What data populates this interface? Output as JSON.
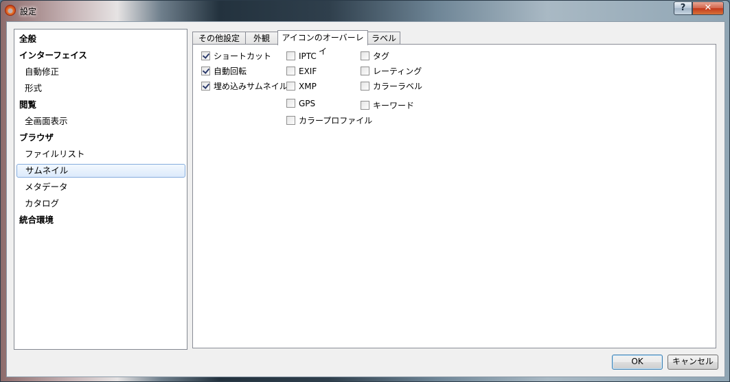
{
  "window": {
    "title": "設定",
    "help_label": "?",
    "close_label": "✕"
  },
  "sidebar": {
    "items": [
      {
        "label": "全般",
        "level": "category"
      },
      {
        "label": "インターフェイス",
        "level": "category"
      },
      {
        "label": "自動修正",
        "level": "child"
      },
      {
        "label": "形式",
        "level": "child"
      },
      {
        "label": "閲覧",
        "level": "category"
      },
      {
        "label": "全画面表示",
        "level": "child"
      },
      {
        "label": "ブラウザ",
        "level": "category"
      },
      {
        "label": "ファイルリスト",
        "level": "child"
      },
      {
        "label": "サムネイル",
        "level": "child",
        "selected": true
      },
      {
        "label": "メタデータ",
        "level": "child"
      },
      {
        "label": "カタログ",
        "level": "child"
      },
      {
        "label": "統合環境",
        "level": "category"
      }
    ]
  },
  "tabs": [
    {
      "label": "その他設定"
    },
    {
      "label": "外観"
    },
    {
      "label": "アイコンのオーバーレイ",
      "active": true
    },
    {
      "label": "ラベル"
    }
  ],
  "overlay_options": {
    "col1": [
      {
        "label": "ショートカット",
        "checked": true
      },
      {
        "label": "自動回転",
        "checked": true
      },
      {
        "label": "埋め込みサムネイル",
        "checked": true
      }
    ],
    "col2": [
      {
        "label": "IPTC",
        "checked": false
      },
      {
        "label": "EXIF",
        "checked": false
      },
      {
        "label": "XMP",
        "checked": false
      },
      {
        "label": "GPS",
        "checked": false
      },
      {
        "label": "カラープロファイル",
        "checked": false
      }
    ],
    "col3": [
      {
        "label": "タグ",
        "checked": false
      },
      {
        "label": "レーティング",
        "checked": false
      },
      {
        "label": "カラーラベル",
        "checked": false
      },
      {
        "label": "キーワード",
        "checked": false
      }
    ]
  },
  "buttons": {
    "ok": "OK",
    "cancel": "キャンセル"
  }
}
